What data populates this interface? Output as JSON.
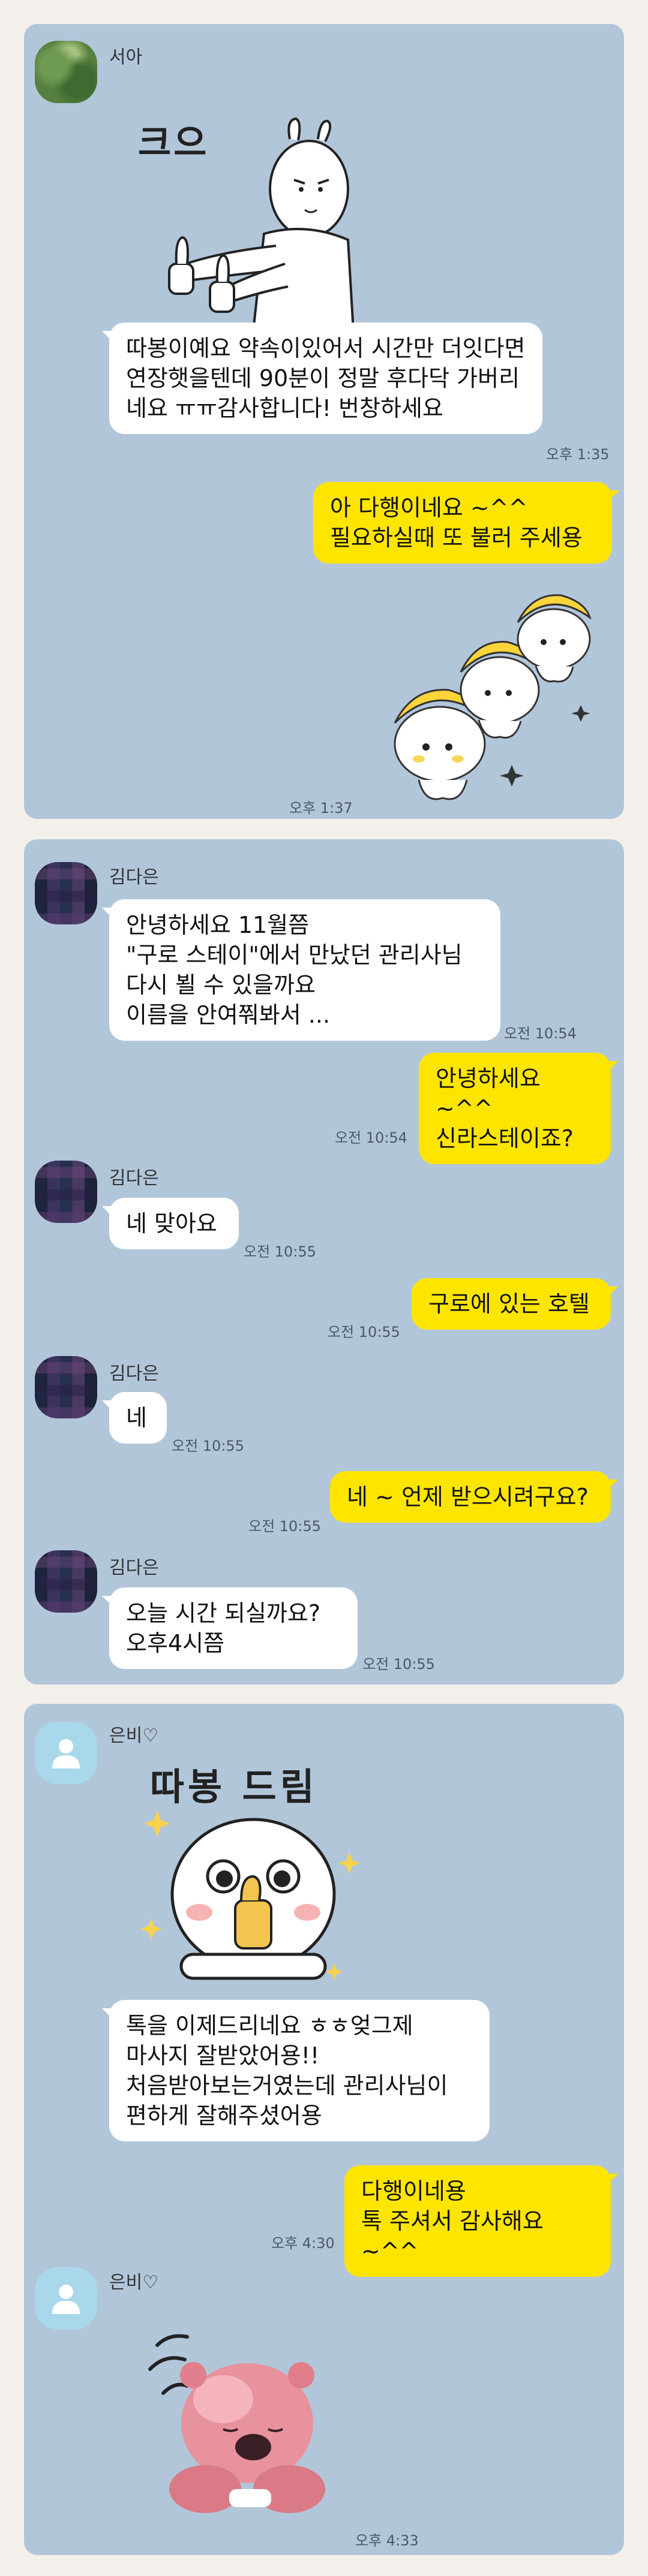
{
  "panel1": {
    "sender": "서아",
    "sticker_caption": "크으",
    "incoming_message": "따봉이예요 약속이있어서 시간만 더잇다면 연장햇을텐데 90분이 정말 후다닥 가버리네요 ㅠㅠ감사합니다! 번창하세요",
    "incoming_time": "오후 1:35",
    "reply_message": "아 다행이네요 ~^^\n필요하실때 또 불러 주세용",
    "reply_time": "오후 1:37"
  },
  "panel2": {
    "sender": "김다은",
    "messages": [
      {
        "from": "them",
        "text": "안녕하세요 11월쯤\n\"구로 스테이\"에서 만났던 관리사님\n다시 뵐 수 있을까요\n이름을 안여쭤봐서 ...",
        "time": "오전 10:54"
      },
      {
        "from": "me",
        "text": "안녕하세요 ~^^\n신라스테이죠?",
        "time": "오전 10:54"
      },
      {
        "from": "them",
        "text": "네 맞아요",
        "time": "오전 10:55"
      },
      {
        "from": "me",
        "text": "구로에 있는 호텔",
        "time": "오전 10:55"
      },
      {
        "from": "them",
        "text": "네",
        "time": "오전 10:55"
      },
      {
        "from": "me",
        "text": "네 ~ 언제 받으시려구요?",
        "time": "오전 10:55"
      },
      {
        "from": "them",
        "text": "오늘  시간 되실까요?\n오후4시쯤",
        "time": "오전 10:55"
      }
    ]
  },
  "panel3": {
    "sender": "은비♡",
    "sticker_caption": "따봉 드림",
    "incoming_message": "톡을 이제드리네요 ㅎㅎ엊그제\n마사지 잘받았어용!!\n처음받아보는거였는데 관리사님이\n편하게 잘해주셨어용",
    "reply_message": "다행이네용\n톡 주셔서 감사해요 ~^^",
    "reply_time": "오후 4:30",
    "sticker_time": "오후 4:33"
  },
  "colors": {
    "chat_background": "#b2c6da",
    "my_bubble": "#fee500",
    "their_bubble": "#ffffff",
    "page_background": "#f3efea"
  }
}
